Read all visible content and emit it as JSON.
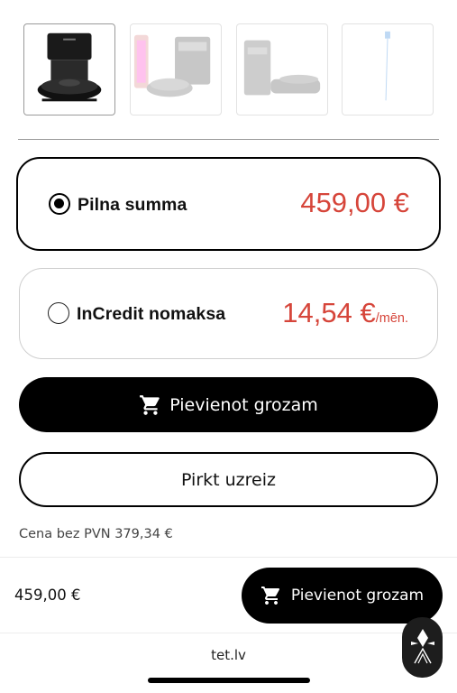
{
  "gallery": {
    "thumbnails": [
      {
        "name": "robot-vacuum-dock-dark",
        "active": true
      },
      {
        "name": "robot-vacuum-app",
        "active": false
      },
      {
        "name": "robot-vacuum-dock-side",
        "active": false
      },
      {
        "name": "robot-vacuum-spec-line",
        "active": false
      }
    ]
  },
  "payment_options": {
    "full": {
      "label": "Pilna summa",
      "price": "459,00 €",
      "selected": true
    },
    "credit": {
      "label": "InCredit nomaksa",
      "price": "14,54 €",
      "unit": "/mēn.",
      "selected": false
    }
  },
  "actions": {
    "add_to_cart": "Pievienot grozam",
    "buy_now": "Pirkt uzreiz"
  },
  "vat_note": "Cena bez PVN 379,34 €",
  "sticky_bar": {
    "price": "459,00 €",
    "add_to_cart": "Pievienot grozam"
  },
  "browser": {
    "domain": "tet.lv"
  },
  "colors": {
    "price": "#d6453a",
    "primary_button": "#000000"
  },
  "icons": {
    "cart": "shopping-cart-icon",
    "fab": "assistant-logo-icon"
  }
}
